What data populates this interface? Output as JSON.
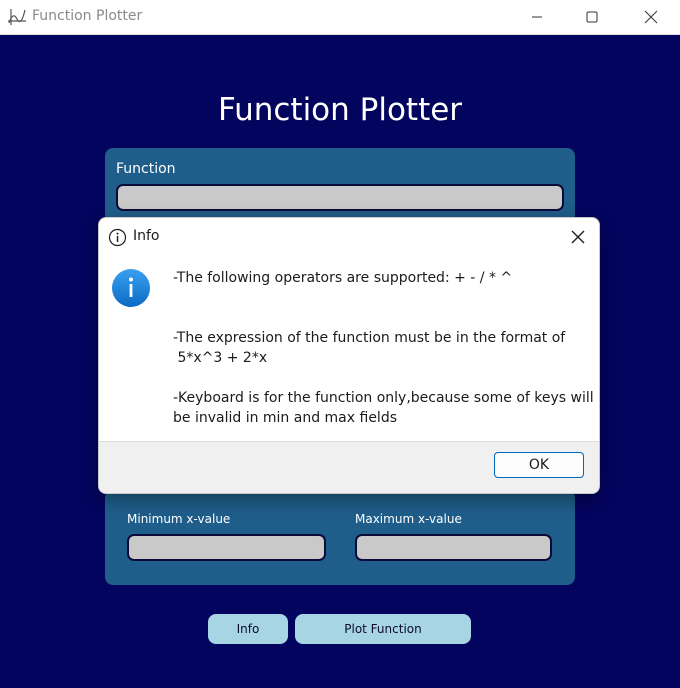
{
  "window": {
    "title": "Function Plotter",
    "icon": "function-graph-icon",
    "controls": [
      "minimize-icon",
      "maximize-icon",
      "close-icon"
    ]
  },
  "app": {
    "heading": "Function Plotter",
    "function_label": "Function",
    "function_value": "",
    "min_label": "Minimum x-value",
    "min_value": "",
    "max_label": "Maximum x-value",
    "max_value": "",
    "info_button": "Info",
    "plot_button": "Plot Function"
  },
  "dialog": {
    "title": "Info",
    "title_icon": "info-outline-icon",
    "body_icon": "info-blue-icon",
    "line1": "-The following operators are supported: + - / * ^",
    "line2": "-The expression of the function must be in the format of",
    "line3": " 5*x^3 + 2*x",
    "line4": "-Keyboard is for the function only,because some of keys will",
    "line5": "be invalid in min and max fields",
    "ok_button": "OK"
  },
  "colors": {
    "background": "#03045e",
    "panel": "#1f5e8a",
    "button": "#a8d5e3",
    "field": "#c9c9c9",
    "accent": "#0067c0"
  }
}
